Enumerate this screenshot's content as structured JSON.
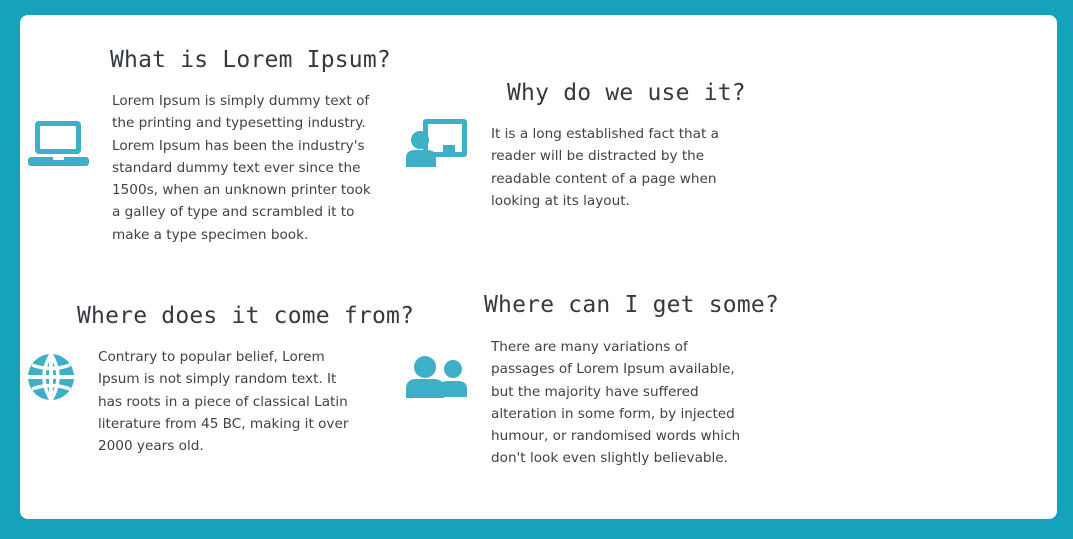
{
  "colors": {
    "background": "#17a2bb",
    "card": "#ffffff",
    "icon": "#3db0c8",
    "heading": "#343a40",
    "text": "#3d4349"
  },
  "sections": [
    {
      "icon": "laptop-icon",
      "title": "What is Lorem Ipsum?",
      "body": "Lorem Ipsum is simply dummy text of the printing and typesetting industry. Lorem Ipsum has been the industry's standard dummy text ever since the 1500s, when an unknown printer took a galley of type and scrambled it to make a type specimen book."
    },
    {
      "icon": "presenter-icon",
      "title": "Why do we use it?",
      "body": "It is a long established fact that a reader will be distracted by the readable content of a page when looking at its layout."
    },
    {
      "icon": "globe-icon",
      "title": "Where does it come from?",
      "body": "Contrary to popular belief, Lorem Ipsum is not simply random text. It has roots in a piece of classical Latin literature from 45 BC, making it over 2000 years old."
    },
    {
      "icon": "users-icon",
      "title": "Where can I get some?",
      "body": "There are many variations of passages of Lorem Ipsum available, but the majority have suffered alteration in some form, by injected humour, or randomised words which don't look even slightly believable."
    }
  ]
}
